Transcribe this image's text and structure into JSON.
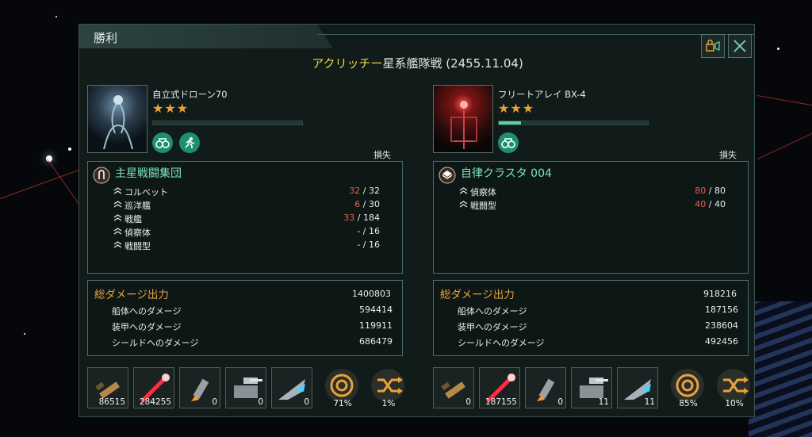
{
  "window": {
    "title": "勝利"
  },
  "battle": {
    "name_highlight": "アクリッチー",
    "name_rest": "星系艦隊戦 (2455.11.04)"
  },
  "icons": {
    "close": "close-icon",
    "camera": "camera-icon"
  },
  "colors": {
    "accent": "#58d2a4",
    "loss": "#f05b4a",
    "damage_title": "#e8a23c",
    "star": "#e8a23c",
    "highlight": "#e9d24a"
  },
  "left": {
    "commander": "自立式ドローン70",
    "stars": "★★★",
    "health_fraction": 0.0,
    "losses_label": "損失",
    "fleet_name": "主星戦闘集団",
    "ships": [
      {
        "name": "コルベット",
        "lost": "32",
        "total": " / 32"
      },
      {
        "name": "巡洋艦",
        "lost": "6",
        "total": " / 30"
      },
      {
        "name": "戦艦",
        "lost": "33",
        "total": " / 184"
      },
      {
        "name": "偵察体",
        "lost": "-",
        "total": " / 16"
      },
      {
        "name": "戦闘型",
        "lost": "-",
        "total": " / 16"
      }
    ],
    "damage": {
      "title": "総ダメージ出力",
      "total": "1400803",
      "rows": [
        {
          "label": "船体へのダメージ",
          "value": "594414"
        },
        {
          "label": "装甲へのダメージ",
          "value": "119911"
        },
        {
          "label": "シールドへのダメージ",
          "value": "686479"
        }
      ]
    },
    "weapons": [
      "86515",
      "284255",
      "0",
      "0",
      "0"
    ],
    "percents": [
      "71%",
      "1%"
    ]
  },
  "right": {
    "commander": "フリートアレイ BX-4",
    "stars": "★★★",
    "health_fraction": 0.15,
    "losses_label": "損失",
    "fleet_name": "自律クラスタ 004",
    "ships": [
      {
        "name": "偵察体",
        "lost": "80",
        "total": " / 80"
      },
      {
        "name": "戦闘型",
        "lost": "40",
        "total": " / 40"
      }
    ],
    "damage": {
      "title": "総ダメージ出力",
      "total": "918216",
      "rows": [
        {
          "label": "船体へのダメージ",
          "value": "187156"
        },
        {
          "label": "装甲へのダメージ",
          "value": "238604"
        },
        {
          "label": "シールドへのダメージ",
          "value": "492456"
        }
      ]
    },
    "weapons": [
      "0",
      "187155",
      "0",
      "11",
      "11"
    ],
    "percents": [
      "85%",
      "10%"
    ]
  }
}
